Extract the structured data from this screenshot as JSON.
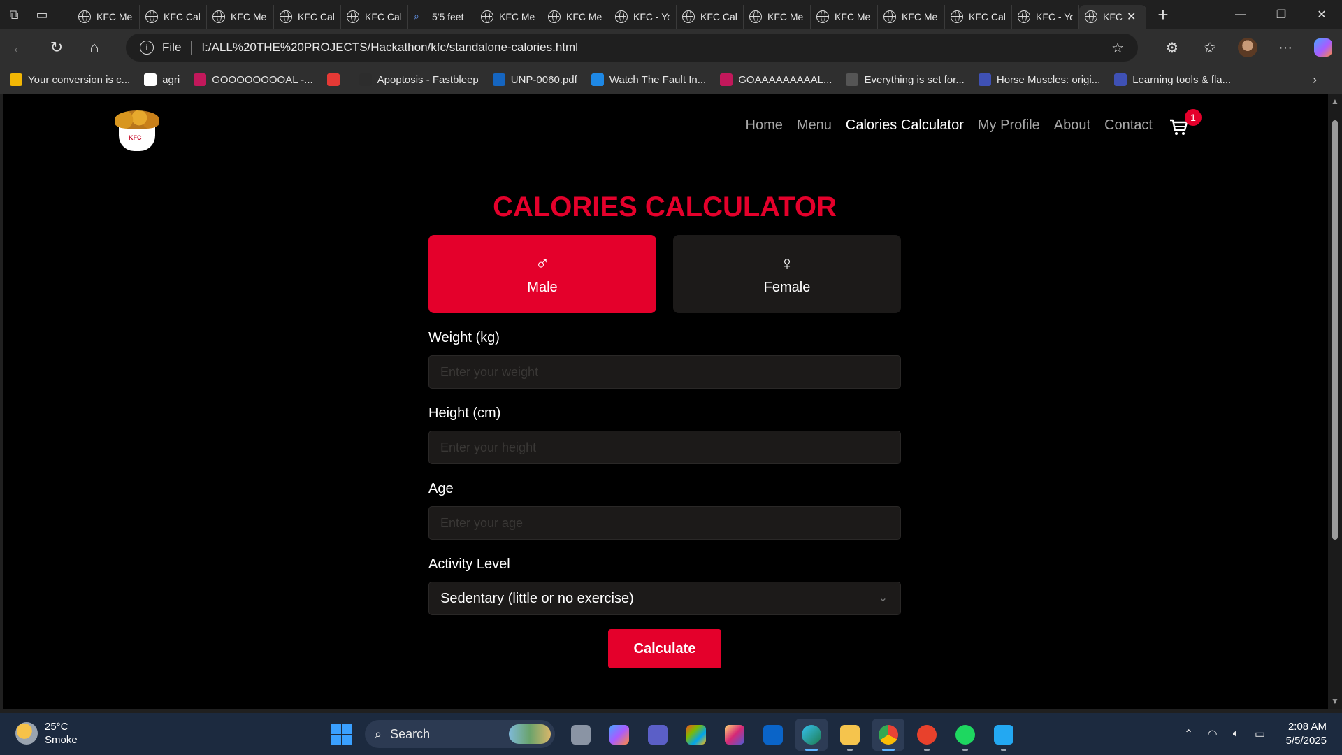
{
  "browser": {
    "tabs": [
      {
        "label": "KFC Me",
        "icon": "globe-icon"
      },
      {
        "label": "KFC Cal",
        "icon": "globe-icon"
      },
      {
        "label": "KFC Me",
        "icon": "globe-icon"
      },
      {
        "label": "KFC Cal",
        "icon": "globe-icon"
      },
      {
        "label": "KFC Cal",
        "icon": "globe-icon"
      },
      {
        "label": "5'5 feet",
        "icon": "search-icon"
      },
      {
        "label": "KFC Me",
        "icon": "globe-icon"
      },
      {
        "label": "KFC Me",
        "icon": "globe-icon"
      },
      {
        "label": "KFC - Yo",
        "icon": "globe-icon"
      },
      {
        "label": "KFC Cal",
        "icon": "globe-icon"
      },
      {
        "label": "KFC Me",
        "icon": "globe-icon"
      },
      {
        "label": "KFC Me",
        "icon": "globe-icon"
      },
      {
        "label": "KFC Me",
        "icon": "globe-icon"
      },
      {
        "label": "KFC Cal",
        "icon": "globe-icon"
      },
      {
        "label": "KFC - Yo",
        "icon": "globe-icon"
      },
      {
        "label": "KFC",
        "icon": "globe-icon",
        "active": true
      }
    ],
    "address": {
      "scheme_label": "File",
      "url": "I:/ALL%20THE%20PROJECTS/Hackathon/kfc/standalone-calories.html"
    },
    "bookmarks": [
      {
        "label": "Your conversion is c...",
        "color": "#f2b705"
      },
      {
        "label": "agri",
        "color": "#ffffff"
      },
      {
        "label": "GOOOOOOOOAL -...",
        "color": "#c2185b"
      },
      {
        "label": "",
        "color": "#e53935"
      },
      {
        "label": "Apoptosis - Fastbleep",
        "color": "#2d2d2d"
      },
      {
        "label": "UNP-0060.pdf",
        "color": "#1565c0"
      },
      {
        "label": "Watch The Fault In...",
        "color": "#1e88e5"
      },
      {
        "label": "GOAAAAAAAAAL...",
        "color": "#c2185b"
      },
      {
        "label": "Everything is set for...",
        "color": "#555555"
      },
      {
        "label": "Horse Muscles: origi...",
        "color": "#3f51b5"
      },
      {
        "label": "Learning tools & fla...",
        "color": "#3f51b5"
      }
    ]
  },
  "site": {
    "nav": [
      {
        "label": "Home"
      },
      {
        "label": "Menu"
      },
      {
        "label": "Calories Calculator",
        "active": true
      },
      {
        "label": "My Profile"
      },
      {
        "label": "About"
      },
      {
        "label": "Contact"
      }
    ],
    "cart_count": "1",
    "accent_color": "#e4002b"
  },
  "calculator": {
    "title": "CALORIES CALCULATOR",
    "gender": {
      "male_symbol": "♂",
      "male_label": "Male",
      "female_symbol": "♀",
      "female_label": "Female",
      "selected": "Male"
    },
    "weight": {
      "label": "Weight (kg)",
      "placeholder": "Enter your weight",
      "value": ""
    },
    "height": {
      "label": "Height (cm)",
      "placeholder": "Enter your height",
      "value": ""
    },
    "age": {
      "label": "Age",
      "placeholder": "Enter your age",
      "value": ""
    },
    "activity": {
      "label": "Activity Level",
      "selected": "Sedentary (little or no exercise)"
    },
    "calculate_label": "Calculate"
  },
  "taskbar": {
    "weather_temp": "25°C",
    "weather_desc": "Smoke",
    "search_label": "Search",
    "time": "2:08 AM",
    "date": "5/5/2025"
  }
}
